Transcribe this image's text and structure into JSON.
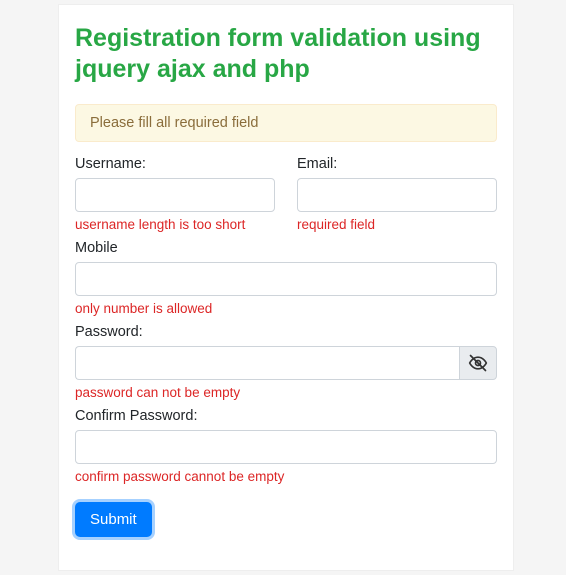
{
  "title": "Registration form validation using jquery ajax and php",
  "alert": "Please fill all required field",
  "fields": {
    "username": {
      "label": "Username:",
      "error": "username length is too short"
    },
    "email": {
      "label": "Email:",
      "error": "required field"
    },
    "mobile": {
      "label": "Mobile",
      "error": "only number is allowed"
    },
    "password": {
      "label": "Password:",
      "error": "password can not be empty"
    },
    "confirm": {
      "label": "Confirm Password:",
      "error": "confirm password cannot be empty"
    }
  },
  "submit_label": "Submit"
}
